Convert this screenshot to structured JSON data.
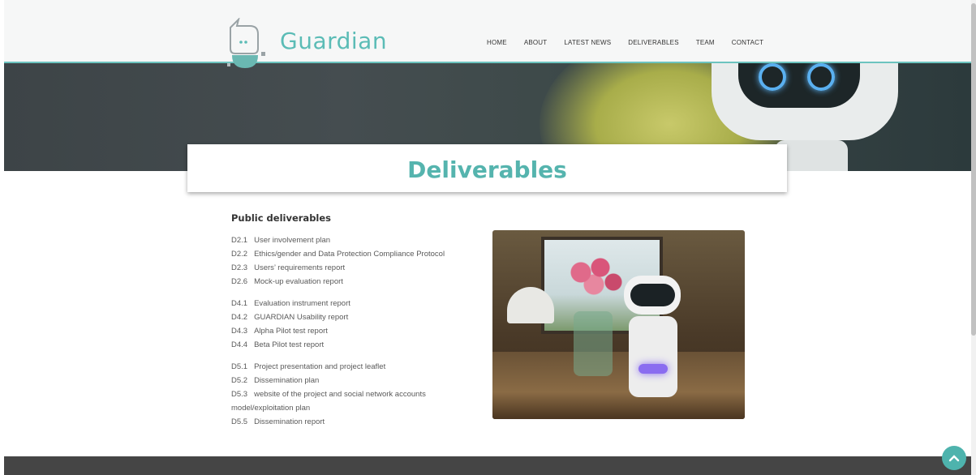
{
  "header": {
    "brand": "Guardian",
    "nav": [
      "HOME",
      "ABOUT",
      "LATEST NEWS",
      "DELIVERABLES",
      "TEAM",
      "CONTACT"
    ]
  },
  "page_title": "Deliverables",
  "section_heading": "Public deliverables",
  "deliverables": [
    [
      {
        "code": "D2.1",
        "title": "User involvement plan"
      },
      {
        "code": "D2.2",
        "title": "Ethics/gender and Data Protection Compliance Protocol"
      },
      {
        "code": "D2.3",
        "title": "Users’ requirements report"
      },
      {
        "code": "D2.6",
        "title": "Mock-up evaluation report"
      }
    ],
    [
      {
        "code": "D4.1",
        "title": "Evaluation instrument report"
      },
      {
        "code": "D4.2",
        "title": "GUARDIAN Usability report"
      },
      {
        "code": "D4.3",
        "title": "Alpha Pilot test report"
      },
      {
        "code": "D4.4",
        "title": "Beta Pilot test report"
      }
    ],
    [
      {
        "code": "D5.1",
        "title": "Project presentation and project leaflet"
      },
      {
        "code": "D5.2",
        "title": "Dissemination plan"
      },
      {
        "code": "D5.3",
        "title": "website of the project and social network accounts"
      },
      {
        "code": "",
        "title": "model/exploitation plan"
      },
      {
        "code": "D5.5",
        "title": "Dissemination report"
      }
    ]
  ],
  "scroll_top_icon": "chevron-up-icon",
  "colors": {
    "accent": "#55b4ae",
    "footer": "#454545"
  }
}
